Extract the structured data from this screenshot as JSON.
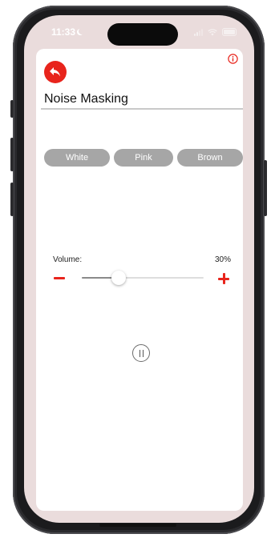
{
  "status_bar": {
    "time": "11:33"
  },
  "header": {
    "title": "Noise Masking"
  },
  "noise_types": [
    {
      "label": "White"
    },
    {
      "label": "Pink"
    },
    {
      "label": "Brown"
    }
  ],
  "volume": {
    "label": "Volume:",
    "value_text": "30%",
    "level": 0.3
  },
  "colors": {
    "accent": "#e8241c",
    "screen_background": "#eadcdc",
    "tab_background": "#a6a6a6"
  },
  "icons": {
    "back": "back-arrow-icon",
    "info": "info-icon",
    "minus": "minus-icon",
    "plus": "plus-icon",
    "pause": "pause-icon"
  }
}
